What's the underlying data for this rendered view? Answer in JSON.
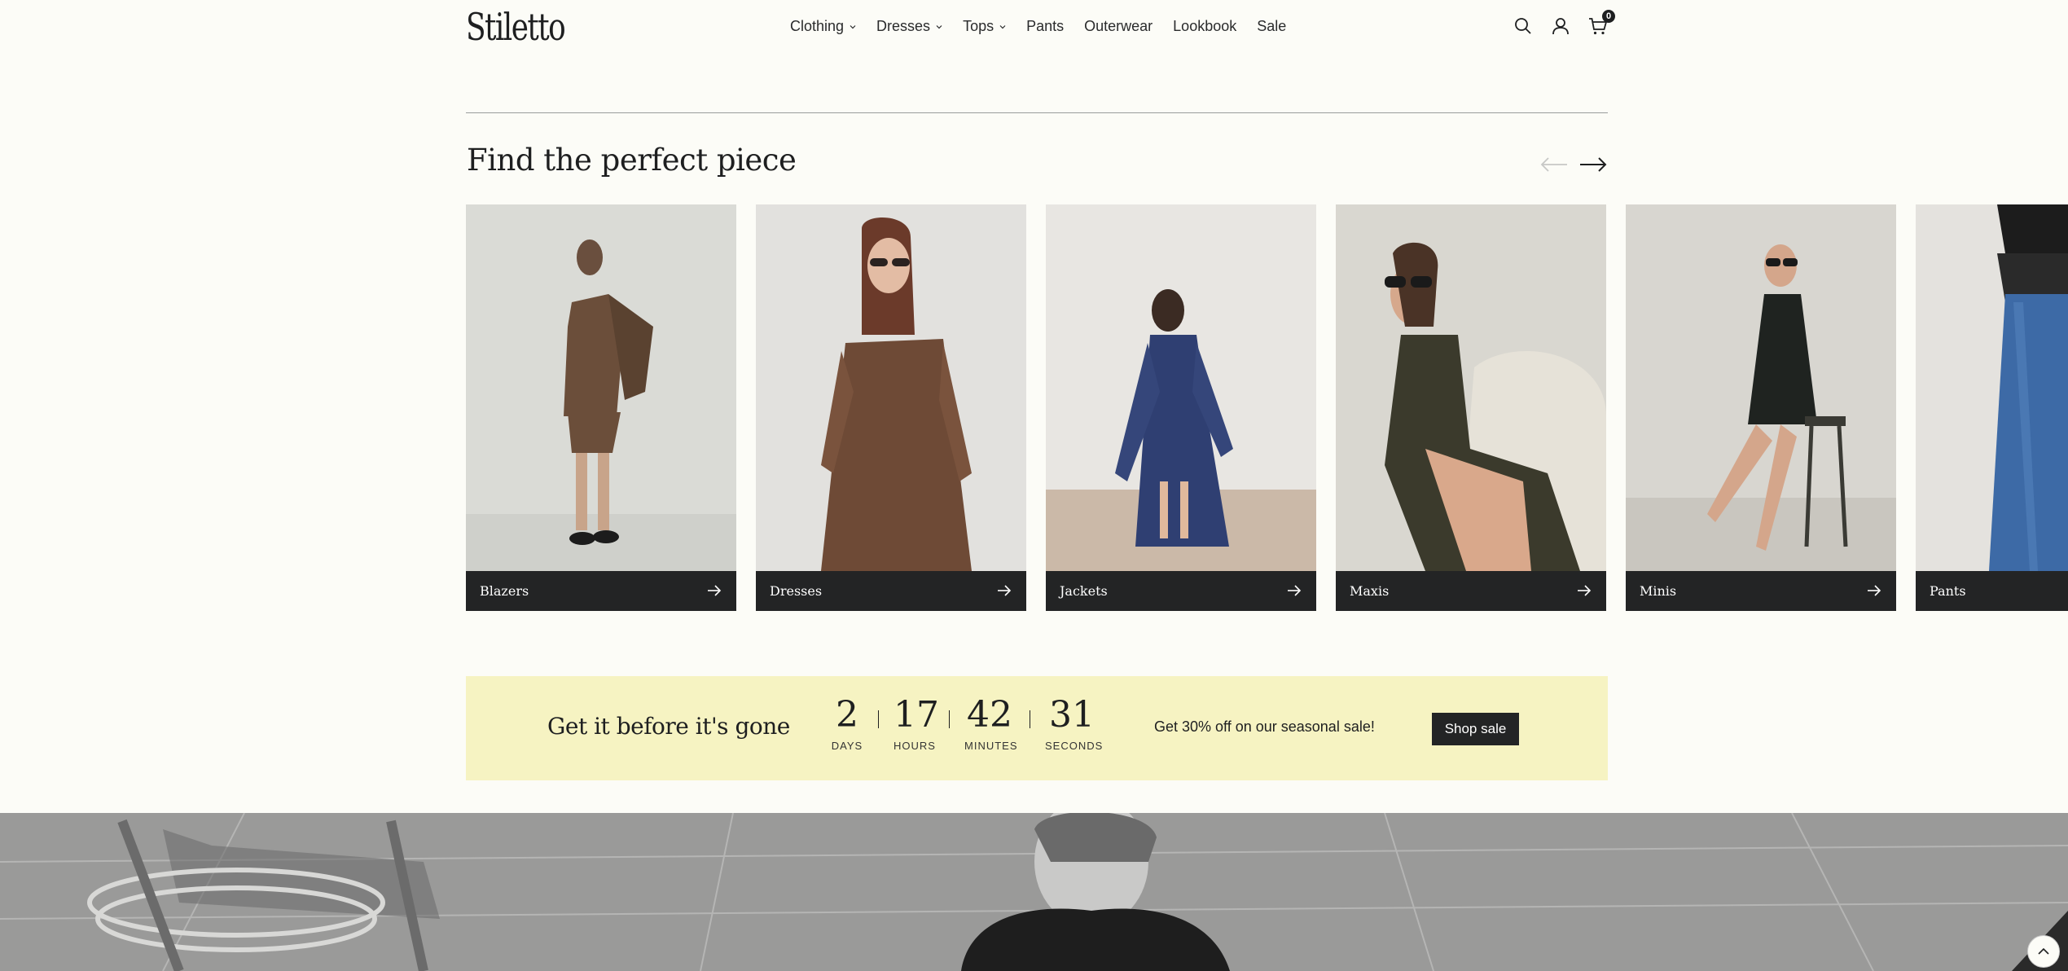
{
  "header": {
    "logo": "Stiletto",
    "nav": [
      {
        "label": "Clothing",
        "dropdown": true
      },
      {
        "label": "Dresses",
        "dropdown": true
      },
      {
        "label": "Tops",
        "dropdown": true
      },
      {
        "label": "Pants",
        "dropdown": false
      },
      {
        "label": "Outerwear",
        "dropdown": false
      },
      {
        "label": "Lookbook",
        "dropdown": false
      },
      {
        "label": "Sale",
        "dropdown": false
      }
    ],
    "icons": [
      "search-icon",
      "account-icon",
      "cart-icon"
    ],
    "cart_count": "0"
  },
  "section": {
    "title": "Find the perfect piece"
  },
  "categories": [
    {
      "label": "Blazers"
    },
    {
      "label": "Dresses"
    },
    {
      "label": "Jackets"
    },
    {
      "label": "Maxis"
    },
    {
      "label": "Minis"
    },
    {
      "label": "Pants"
    }
  ],
  "promo": {
    "title": "Get it before it's gone",
    "countdown": [
      {
        "value": "2",
        "label": "DAYS"
      },
      {
        "value": "17",
        "label": "HOURS"
      },
      {
        "value": "42",
        "label": "MINUTES"
      },
      {
        "value": "31",
        "label": "SECONDS"
      }
    ],
    "text": "Get 30% off on our seasonal sale!",
    "button": "Shop sale"
  },
  "colors": {
    "background": "#fcfcf7",
    "dark": "#232425",
    "promo_bg": "#f6f3c2"
  }
}
